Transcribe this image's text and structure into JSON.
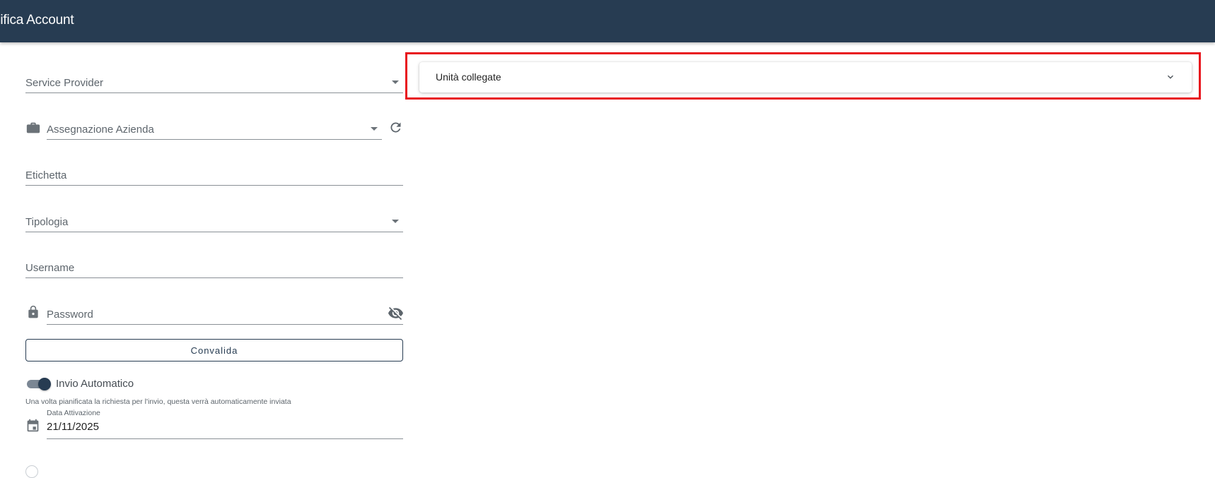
{
  "header": {
    "title": "difica Account"
  },
  "form": {
    "service_provider": {
      "label": "Service Provider"
    },
    "assegnazione_azienda": {
      "label": "Assegnazione Azienda"
    },
    "etichetta": {
      "label": "Etichetta"
    },
    "tipologia": {
      "label": "Tipologia"
    },
    "username": {
      "label": "Username"
    },
    "password": {
      "label": "Password"
    },
    "convalida_label": "Convalida",
    "invio_automatico": {
      "label": "Invio Automatico",
      "enabled": true,
      "hint": "Una volta pianificata la richiesta per l'invio, questa verrà automaticamente inviata"
    },
    "data_attivazione": {
      "label": "Data Attivazione",
      "value": "21/11/2025"
    }
  },
  "panel": {
    "title": "Unità collegate"
  },
  "colors": {
    "header_bg": "#273c52",
    "highlight": "#e8141d",
    "toggle_thumb": "#273c52"
  },
  "icons": {
    "company": "briefcase-icon",
    "refresh": "refresh-icon",
    "lock": "lock-icon",
    "visibility": "visibility-off-icon",
    "calendar": "calendar-icon",
    "expand": "chevron-down-icon"
  }
}
